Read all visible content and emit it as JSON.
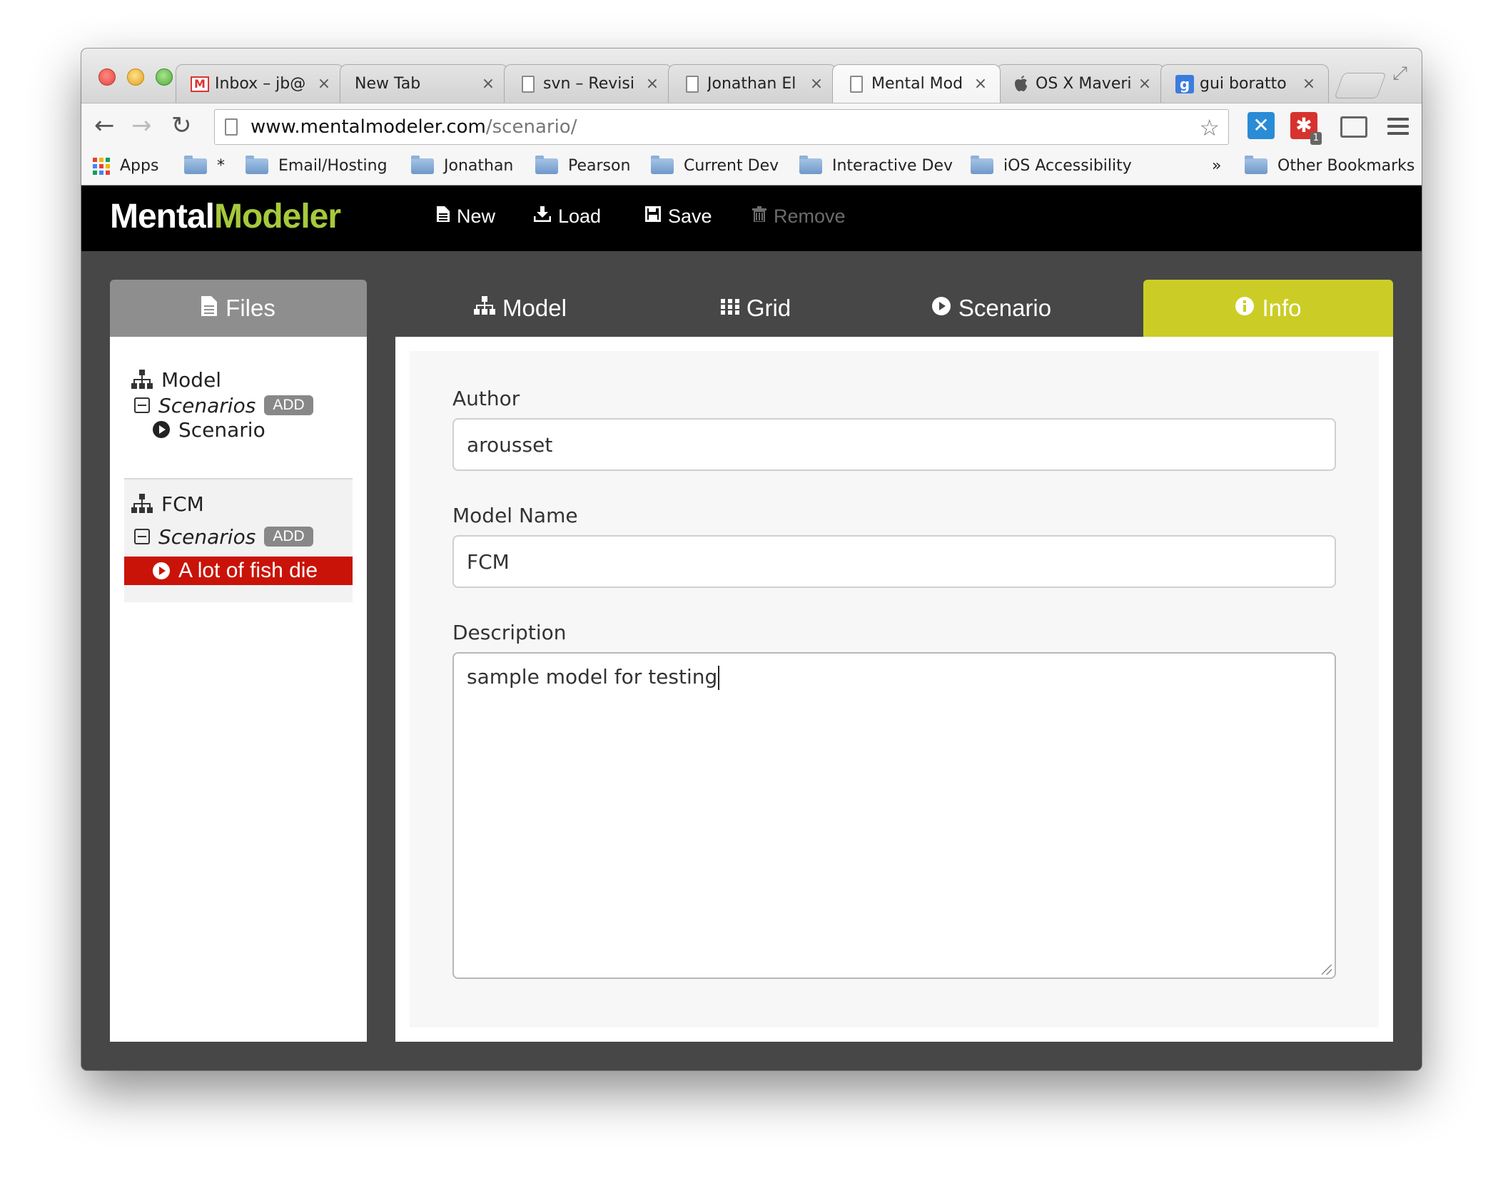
{
  "browser": {
    "tabs": [
      {
        "title": "Inbox – jb@",
        "icon": "gmail-icon"
      },
      {
        "title": "New Tab",
        "icon": ""
      },
      {
        "title": "svn – Revisi",
        "icon": "page-icon"
      },
      {
        "title": "Jonathan El",
        "icon": "page-icon"
      },
      {
        "title": "Mental Mod",
        "icon": "page-icon"
      },
      {
        "title": "OS X Maveri",
        "icon": "apple-icon"
      },
      {
        "title": "gui boratto",
        "icon": "google-icon"
      }
    ],
    "active_tab": 4,
    "close_glyph": "×",
    "url_host": "www.mentalmodeler.com",
    "url_path": "/scenario/",
    "bookmarks": {
      "apps": "Apps",
      "items": [
        "*",
        "Email/Hosting",
        "Jonathan",
        "Pearson",
        "Current Dev",
        "Interactive Dev",
        "iOS Accessibility"
      ],
      "overflow": "»",
      "other": "Other Bookmarks"
    },
    "extension_badge": "1"
  },
  "app": {
    "logo_part1": "Mental",
    "logo_part2": "Modeler",
    "logo_accent_color": "#a7c93c",
    "header_buttons": {
      "new": "New",
      "load": "Load",
      "save": "Save",
      "remove": "Remove"
    },
    "files_tab": "Files",
    "tree": {
      "group1": {
        "model": "Model",
        "scenarios": "Scenarios",
        "add": "ADD",
        "scenario": "Scenario"
      },
      "group2": {
        "model": "FCM",
        "scenarios": "Scenarios",
        "add": "ADD",
        "scenario": "A lot of fish die"
      }
    },
    "tabs": {
      "model": "Model",
      "grid": "Grid",
      "scenario": "Scenario",
      "info": "Info"
    },
    "active_tab_color": "#cbcd26",
    "selected_color": "#c91308",
    "form": {
      "author_label": "Author",
      "author_value": "arousset",
      "model_name_label": "Model Name",
      "model_name_value": "FCM",
      "description_label": "Description",
      "description_value": "sample model for testing"
    }
  }
}
